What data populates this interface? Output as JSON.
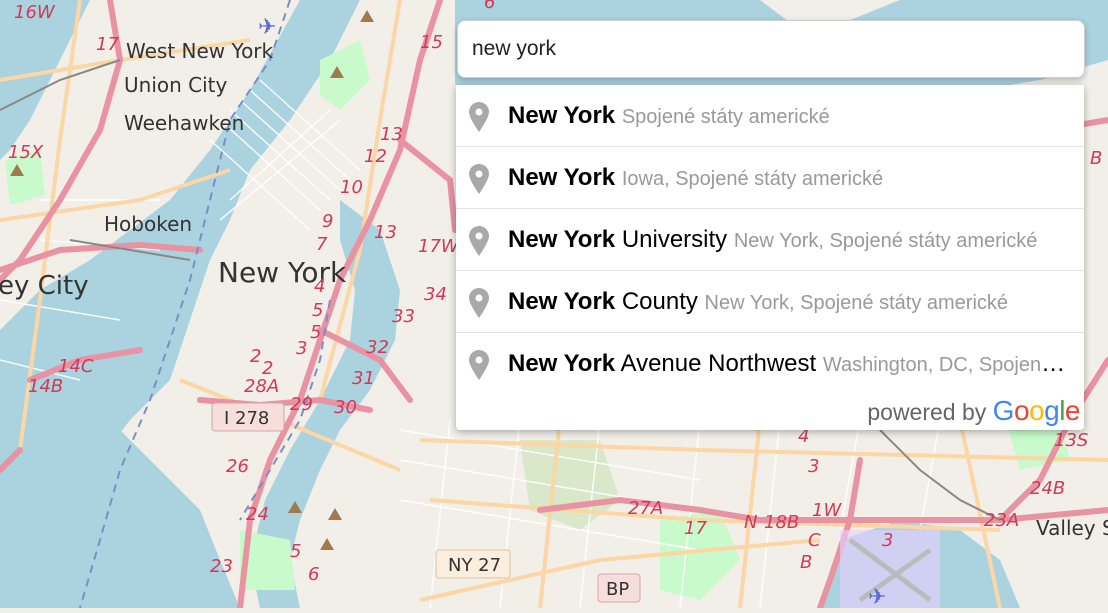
{
  "search": {
    "value": "new york"
  },
  "suggestions": [
    {
      "match": "New York",
      "rest": "",
      "secondary": "Spojené státy americké"
    },
    {
      "match": "New York",
      "rest": "",
      "secondary": "Iowa, Spojené státy americké"
    },
    {
      "match": "New York",
      "rest": " University",
      "secondary": "New York, Spojené státy americké"
    },
    {
      "match": "New York",
      "rest": " County",
      "secondary": "New York, Spojené státy americké"
    },
    {
      "match": "New York",
      "rest": " Avenue Northwest",
      "secondary": "Washington, DC, Spojené státy americké"
    }
  ],
  "powered": {
    "prefix": "powered by",
    "logo": [
      "G",
      "o",
      "o",
      "g",
      "l",
      "e"
    ],
    "logo_colors": [
      "#4285F4",
      "#EA4335",
      "#FBBC05",
      "#4285F4",
      "#34A853",
      "#EA4335"
    ]
  },
  "map_labels": {
    "west_new_york": "West New York",
    "union_city": "Union City",
    "weehawken": "Weehawken",
    "hoboken": "Hoboken",
    "new_york": "New York",
    "jersey_city": "ey City",
    "valley_stream": "Valley Str"
  },
  "map_shields": {
    "i278": "I 278",
    "ny27": "NY 27",
    "bp": "BP"
  },
  "map_route_numbers": [
    "16W",
    "17",
    "15X",
    "15",
    "6",
    "13",
    "12",
    "10",
    "9",
    "7",
    "13",
    "17W",
    "34",
    "33",
    "32",
    "31",
    "30",
    "29",
    "28A",
    "26",
    "24",
    "23",
    "2",
    "3",
    "5",
    "4",
    "5",
    "14C",
    "14B",
    "2",
    "27A",
    "17",
    "1W",
    "18B",
    "23A",
    "24B",
    "13S",
    "4",
    "3",
    "N",
    "C",
    "B",
    "5",
    "6",
    "3",
    "B"
  ],
  "colors": {
    "water": "#aad3df",
    "land": "#f2efe9",
    "motorway": "#e892a2",
    "primary": "#fcd6a4",
    "park": "#c8facc",
    "pin": "#a9a9a9"
  }
}
